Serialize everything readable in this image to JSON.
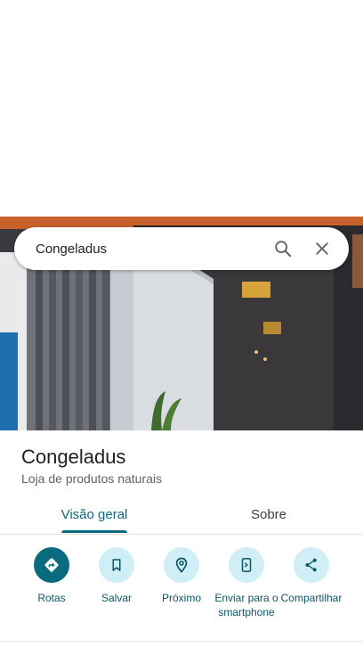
{
  "search": {
    "query": "Congeladus"
  },
  "place": {
    "name": "Congeladus",
    "category": "Loja de produtos naturais"
  },
  "tabs": [
    {
      "label": "Visão geral",
      "active": true
    },
    {
      "label": "Sobre",
      "active": false
    }
  ],
  "actions": [
    {
      "label": "Rotas",
      "icon": "directions-icon"
    },
    {
      "label": "Salvar",
      "icon": "bookmark-icon"
    },
    {
      "label": "Próximo",
      "icon": "nearby-icon"
    },
    {
      "label": "Enviar para o smartphone",
      "icon": "send-to-phone-icon"
    },
    {
      "label": "Compartilhar",
      "icon": "share-icon"
    }
  ],
  "colors": {
    "accent": "#0b6b7e",
    "action_bg": "#cfeef5",
    "text_primary": "#202124",
    "text_secondary": "#5f6368"
  }
}
